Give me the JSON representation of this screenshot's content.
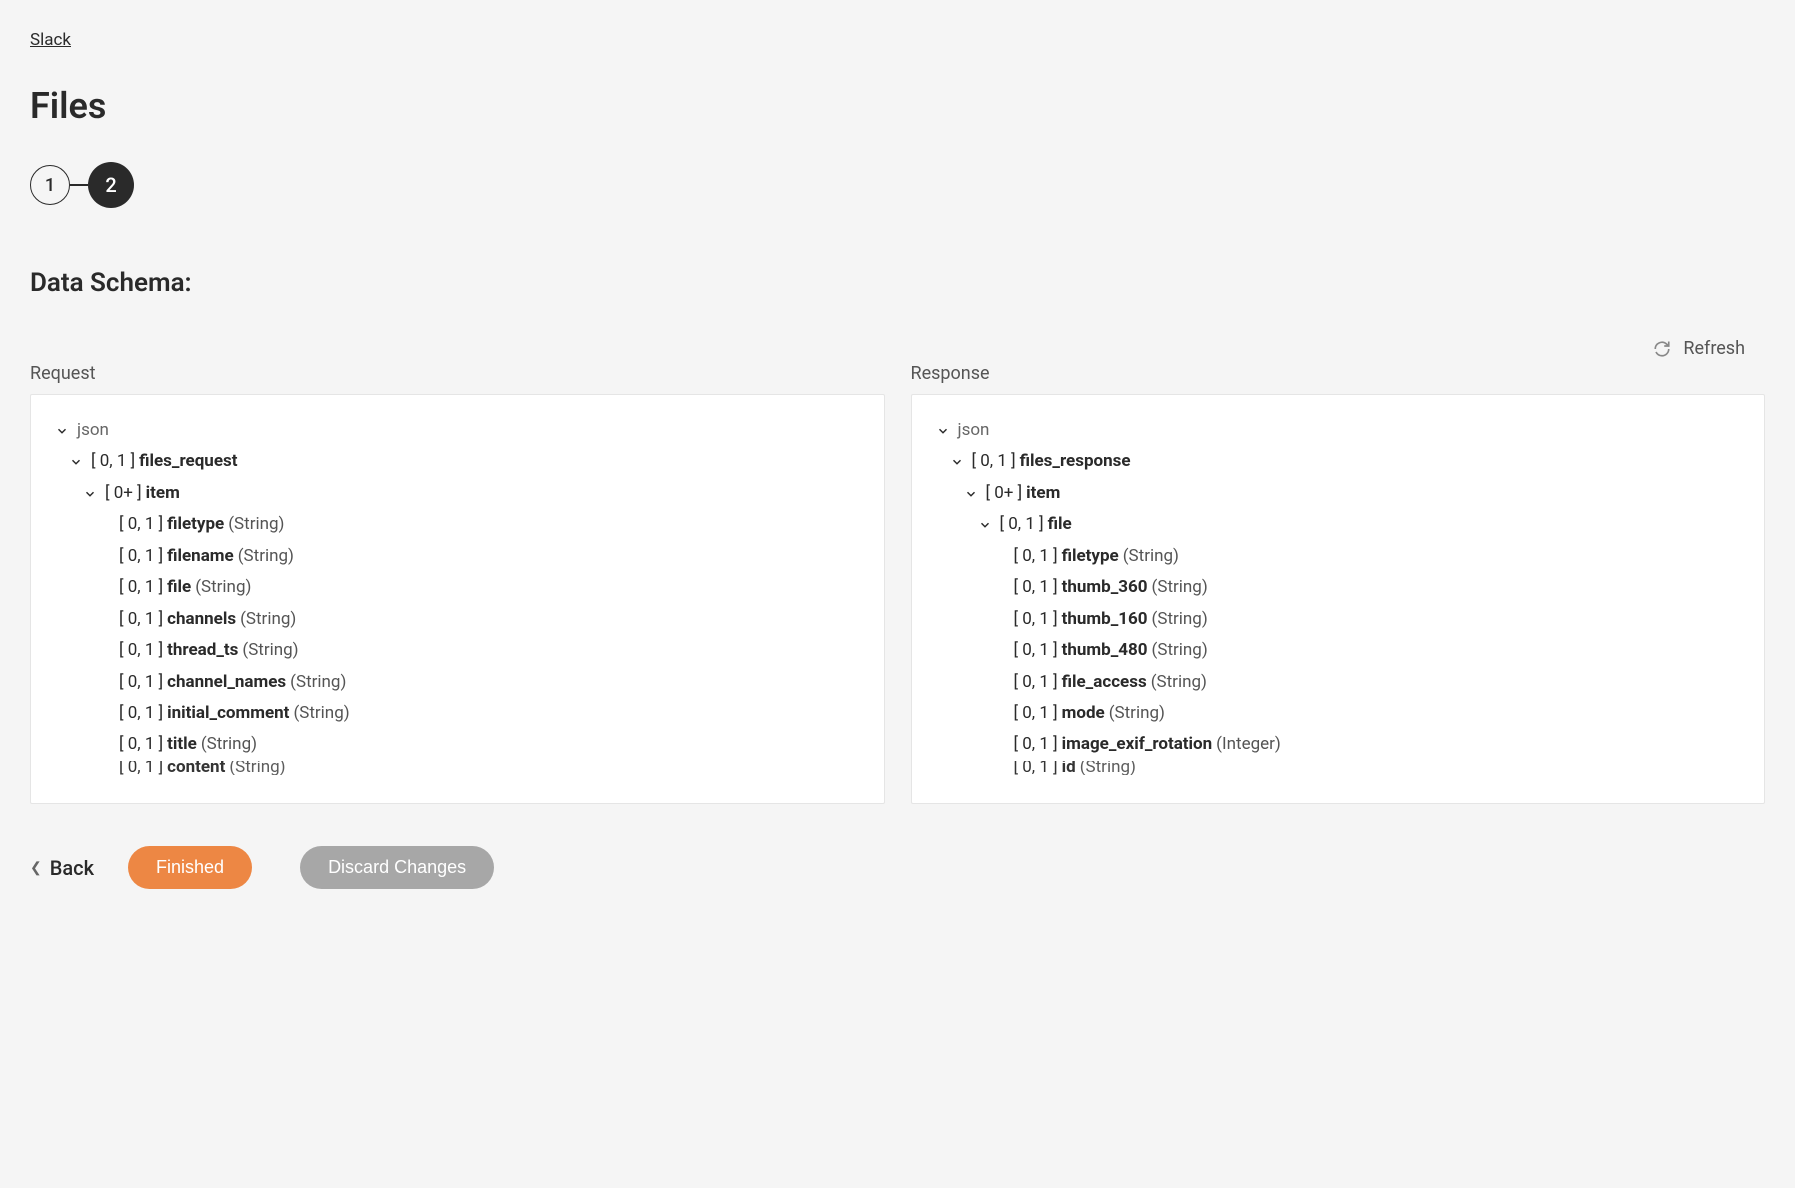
{
  "breadcrumb": {
    "label": "Slack"
  },
  "page": {
    "title": "Files"
  },
  "stepper": {
    "steps": [
      "1",
      "2"
    ],
    "active_index": 1
  },
  "section": {
    "title": "Data Schema:"
  },
  "refresh": {
    "label": "Refresh"
  },
  "panels": {
    "request": {
      "header": "Request",
      "root_label": "json",
      "tree": [
        {
          "depth": 1,
          "expandable": true,
          "cardinality": "[ 0, 1 ]",
          "name": "files_request",
          "type": null
        },
        {
          "depth": 2,
          "expandable": true,
          "cardinality": "[ 0+ ]",
          "name": "item",
          "type": null
        },
        {
          "depth": 3,
          "expandable": false,
          "cardinality": "[ 0, 1 ]",
          "name": "filetype",
          "type": "(String)"
        },
        {
          "depth": 3,
          "expandable": false,
          "cardinality": "[ 0, 1 ]",
          "name": "filename",
          "type": "(String)"
        },
        {
          "depth": 3,
          "expandable": false,
          "cardinality": "[ 0, 1 ]",
          "name": "file",
          "type": "(String)"
        },
        {
          "depth": 3,
          "expandable": false,
          "cardinality": "[ 0, 1 ]",
          "name": "channels",
          "type": "(String)"
        },
        {
          "depth": 3,
          "expandable": false,
          "cardinality": "[ 0, 1 ]",
          "name": "thread_ts",
          "type": "(String)"
        },
        {
          "depth": 3,
          "expandable": false,
          "cardinality": "[ 0, 1 ]",
          "name": "channel_names",
          "type": "(String)"
        },
        {
          "depth": 3,
          "expandable": false,
          "cardinality": "[ 0, 1 ]",
          "name": "initial_comment",
          "type": "(String)"
        },
        {
          "depth": 3,
          "expandable": false,
          "cardinality": "[ 0, 1 ]",
          "name": "title",
          "type": "(String)"
        },
        {
          "depth": 3,
          "expandable": false,
          "cardinality": "[ 0, 1 ]",
          "name": "content",
          "type": "(String)",
          "partial": true
        }
      ]
    },
    "response": {
      "header": "Response",
      "root_label": "json",
      "tree": [
        {
          "depth": 1,
          "expandable": true,
          "cardinality": "[ 0, 1 ]",
          "name": "files_response",
          "type": null
        },
        {
          "depth": 2,
          "expandable": true,
          "cardinality": "[ 0+ ]",
          "name": "item",
          "type": null
        },
        {
          "depth": 3,
          "expandable": true,
          "cardinality": "[ 0, 1 ]",
          "name": "file",
          "type": null
        },
        {
          "depth": 4,
          "expandable": false,
          "cardinality": "[ 0, 1 ]",
          "name": "filetype",
          "type": "(String)"
        },
        {
          "depth": 4,
          "expandable": false,
          "cardinality": "[ 0, 1 ]",
          "name": "thumb_360",
          "type": "(String)"
        },
        {
          "depth": 4,
          "expandable": false,
          "cardinality": "[ 0, 1 ]",
          "name": "thumb_160",
          "type": "(String)"
        },
        {
          "depth": 4,
          "expandable": false,
          "cardinality": "[ 0, 1 ]",
          "name": "thumb_480",
          "type": "(String)"
        },
        {
          "depth": 4,
          "expandable": false,
          "cardinality": "[ 0, 1 ]",
          "name": "file_access",
          "type": "(String)"
        },
        {
          "depth": 4,
          "expandable": false,
          "cardinality": "[ 0, 1 ]",
          "name": "mode",
          "type": "(String)"
        },
        {
          "depth": 4,
          "expandable": false,
          "cardinality": "[ 0, 1 ]",
          "name": "image_exif_rotation",
          "type": "(Integer)"
        },
        {
          "depth": 4,
          "expandable": false,
          "cardinality": "[ 0, 1 ]",
          "name": "id",
          "type": "(String)",
          "partial": true
        }
      ]
    }
  },
  "footer": {
    "back": "Back",
    "finished": "Finished",
    "discard": "Discard Changes"
  }
}
